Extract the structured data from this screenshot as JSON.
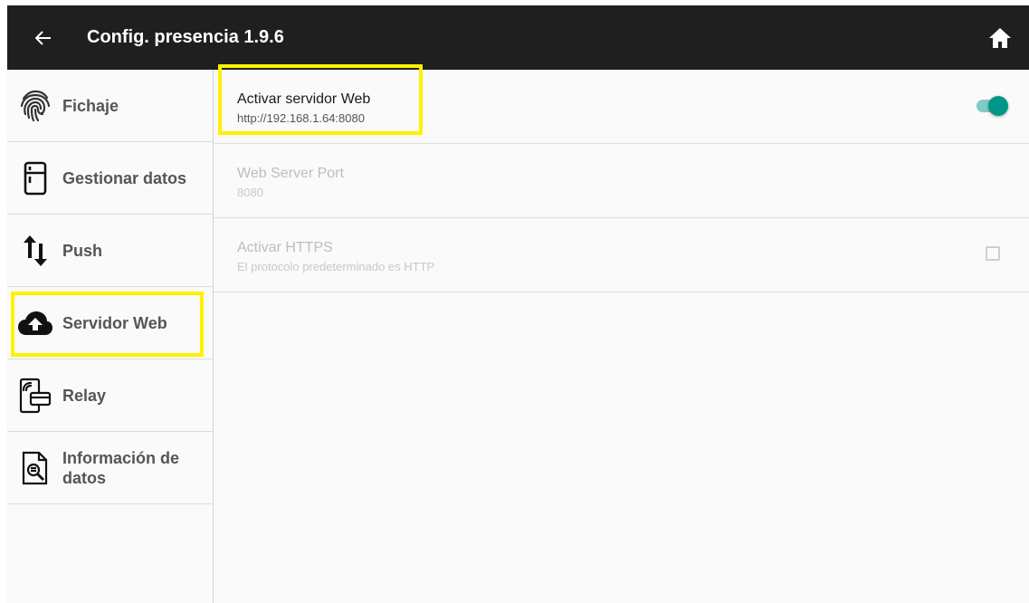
{
  "header": {
    "title": "Config. presencia 1.9.6",
    "back_icon": "arrow-left-icon",
    "home_icon": "home-icon"
  },
  "sidebar": {
    "items": [
      {
        "label": "Fichaje",
        "icon": "fingerprint-icon"
      },
      {
        "label": "Gestionar datos",
        "icon": "fridge-icon"
      },
      {
        "label": "Push",
        "icon": "swap-vertical-icon"
      },
      {
        "label": "Servidor Web",
        "icon": "cloud-upload-icon",
        "selected": true
      },
      {
        "label": "Relay",
        "icon": "door-card-icon"
      },
      {
        "label": "Información de datos",
        "icon": "document-search-icon"
      }
    ]
  },
  "prefs": [
    {
      "title": "Activar servidor Web",
      "summary": "http://192.168.1.64:8080",
      "control": "switch",
      "checked": true,
      "enabled": true
    },
    {
      "title": "Web Server Port",
      "summary": "8080",
      "control": "none",
      "enabled": false
    },
    {
      "title": "Activar HTTPS",
      "summary": "El protocolo predeterminado es HTTP",
      "control": "checkbox",
      "checked": false,
      "enabled": false
    }
  ],
  "colors": {
    "appbar": "#1f1f1f",
    "accent": "#009688",
    "highlight": "#fff200"
  }
}
